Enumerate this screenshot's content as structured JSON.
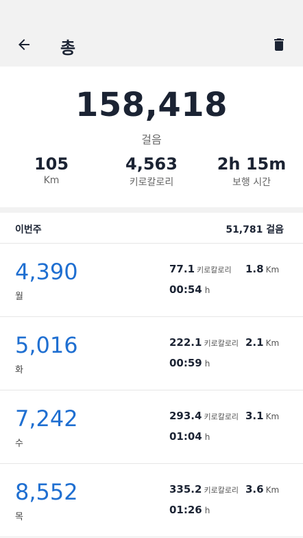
{
  "header": {
    "title": "총",
    "back_icon": "arrow-left-icon",
    "delete_icon": "trash-icon"
  },
  "summary": {
    "total_steps": "158,418",
    "steps_unit": "걸음",
    "distance": {
      "value": "105",
      "unit": "Km"
    },
    "calories": {
      "value": "4,563",
      "unit": "키로칼로리"
    },
    "walk_time": {
      "value": "2h 15m",
      "unit": "보행 시간"
    }
  },
  "week": {
    "label": "이번주",
    "total": "51,781 걸음"
  },
  "days": [
    {
      "steps": "4,390",
      "day": "월",
      "kcal": "77.1",
      "kcal_unit": "키로칼로리",
      "km": "1.8",
      "km_unit": "Km",
      "time": "00:54",
      "time_unit": "h"
    },
    {
      "steps": "5,016",
      "day": "화",
      "kcal": "222.1",
      "kcal_unit": "키로칼로리",
      "km": "2.1",
      "km_unit": "Km",
      "time": "00:59",
      "time_unit": "h"
    },
    {
      "steps": "7,242",
      "day": "수",
      "kcal": "293.4",
      "kcal_unit": "키로칼로리",
      "km": "3.1",
      "km_unit": "Km",
      "time": "01:04",
      "time_unit": "h"
    },
    {
      "steps": "8,552",
      "day": "목",
      "kcal": "335.2",
      "kcal_unit": "키로칼로리",
      "km": "3.6",
      "km_unit": "Km",
      "time": "01:26",
      "time_unit": "h"
    }
  ],
  "colors": {
    "accent_blue": "#1f6fd1",
    "header_bg": "#f2f2f2",
    "text_dark": "#1b2333"
  }
}
